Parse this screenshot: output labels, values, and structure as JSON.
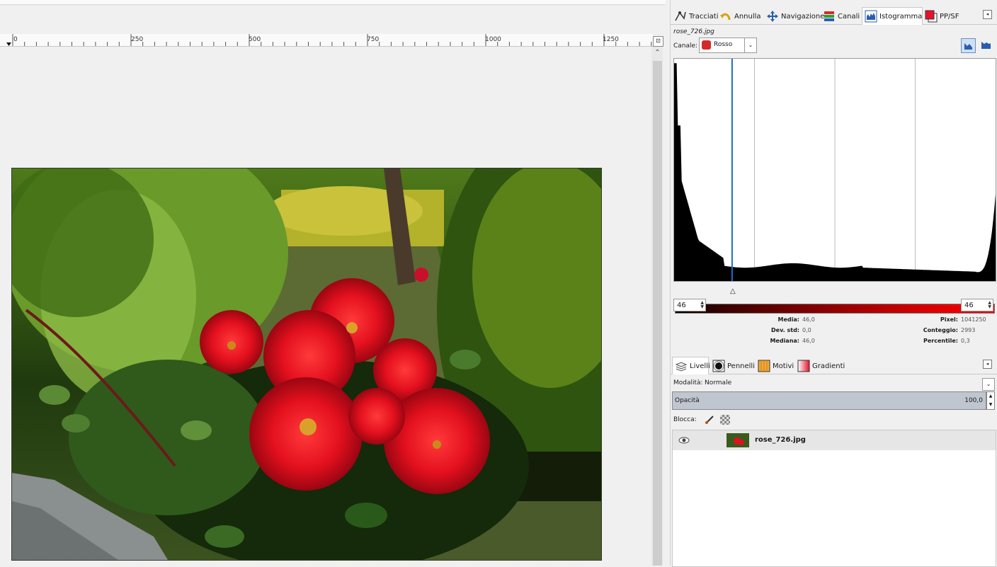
{
  "canvas": {
    "ruler_labels": [
      "0",
      "250",
      "500",
      "750",
      "1000",
      "1250"
    ]
  },
  "dock_top": {
    "tabs": [
      {
        "label": "Tracciati",
        "icon": "paths-icon"
      },
      {
        "label": "Annulla",
        "icon": "undo-icon"
      },
      {
        "label": "Navigazione",
        "icon": "navigation-icon"
      },
      {
        "label": "Canali",
        "icon": "channels-icon"
      },
      {
        "label": "Istogramma",
        "icon": "histogram-icon"
      },
      {
        "label": "PP/SF",
        "icon": "fg-bg-colors-icon"
      }
    ],
    "active_tab": "Istogramma"
  },
  "histogram": {
    "filename": "rose_726.jpg",
    "channel_label": "Canale:",
    "channel_value": "Rosso",
    "range_start": "46",
    "range_end": "46",
    "stats_left": [
      {
        "label": "Media:",
        "value": "46,0"
      },
      {
        "label": "Dev. std:",
        "value": "0,0"
      },
      {
        "label": "Mediana:",
        "value": "46,0"
      }
    ],
    "stats_right": [
      {
        "label": "Pixel:",
        "value": "1041250"
      },
      {
        "label": "Conteggio:",
        "value": "2993"
      },
      {
        "label": "Percentile:",
        "value": "0,3"
      }
    ],
    "marker_value": 46
  },
  "dock_bottom": {
    "tabs": [
      {
        "label": "Livelli",
        "icon": "layers-icon"
      },
      {
        "label": "Pennelli",
        "icon": "brushes-icon"
      },
      {
        "label": "Motivi",
        "icon": "patterns-icon"
      },
      {
        "label": "Gradienti",
        "icon": "gradients-icon"
      }
    ],
    "mode_label": "Modalità:",
    "mode_value": "Normale",
    "opacity_label": "Opacità",
    "opacity_value": "100,0",
    "lock_label": "Blocca:",
    "layer_name": "rose_726.jpg"
  },
  "colors": {
    "accent": "#1a6fc0",
    "selection_bar": "#bfc6cf",
    "rose_red": "#e0101e"
  }
}
